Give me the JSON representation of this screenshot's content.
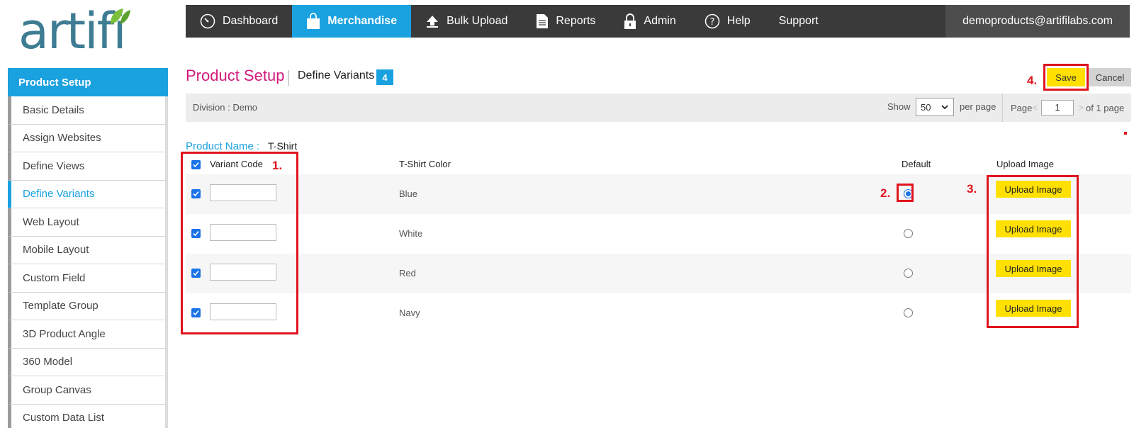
{
  "logo": {
    "text": "artifi"
  },
  "nav": {
    "items": [
      {
        "label": "Dashboard",
        "icon": "speedometer-icon",
        "active": false
      },
      {
        "label": "Merchandise",
        "icon": "shopping-bag-icon",
        "active": true
      },
      {
        "label": "Bulk Upload",
        "icon": "upload-icon",
        "active": false
      },
      {
        "label": "Reports",
        "icon": "document-icon",
        "active": false
      },
      {
        "label": "Admin",
        "icon": "lock-icon",
        "active": false
      },
      {
        "label": "Help",
        "icon": "help-icon",
        "active": false
      },
      {
        "label": "Support",
        "icon": "",
        "active": false
      }
    ],
    "user": "demoproducts@artifilabs.com"
  },
  "sidebar": {
    "header": "Product Setup",
    "items": [
      {
        "label": "Basic Details",
        "active": false
      },
      {
        "label": "Assign Websites",
        "active": false
      },
      {
        "label": "Define Views",
        "active": false
      },
      {
        "label": "Define Variants",
        "active": true
      },
      {
        "label": "Web Layout",
        "active": false
      },
      {
        "label": "Mobile Layout",
        "active": false
      },
      {
        "label": "Custom Field",
        "active": false
      },
      {
        "label": "Template Group",
        "active": false
      },
      {
        "label": "3D Product Angle",
        "active": false
      },
      {
        "label": "360 Model",
        "active": false
      },
      {
        "label": "Group Canvas",
        "active": false
      },
      {
        "label": "Custom Data List",
        "active": false
      }
    ]
  },
  "header": {
    "title": "Product Setup",
    "subtitle": "Define Variants",
    "step": "4",
    "save_label": "Save",
    "cancel_label": "Cancel"
  },
  "filter": {
    "division": "Division :  Demo",
    "show_label": "Show",
    "show_value": "50",
    "per_page_label": "per page",
    "page_label": "Page",
    "prev": "<",
    "page_value": "1",
    "next": ">",
    "of_label": "of 1 page"
  },
  "product": {
    "name_label": "Product Name :",
    "name_value": "T-Shirt"
  },
  "table": {
    "headers": {
      "code": "Variant Code",
      "color": "T-Shirt Color",
      "default": "Default",
      "upload": "Upload Image"
    },
    "rows": [
      {
        "code": "",
        "color": "Blue",
        "default": true,
        "upload": "Upload Image"
      },
      {
        "code": "",
        "color": "White",
        "default": false,
        "upload": "Upload Image"
      },
      {
        "code": "",
        "color": "Red",
        "default": false,
        "upload": "Upload Image"
      },
      {
        "code": "",
        "color": "Navy",
        "default": false,
        "upload": "Upload Image"
      }
    ]
  },
  "annotations": {
    "n1": "1.",
    "n2": "2.",
    "n3": "3.",
    "n4": "4."
  },
  "colors": {
    "accent": "#1aa1e0",
    "title": "#d21a7b",
    "button_yellow": "#ffe000",
    "annotation_red": "#e0141e"
  }
}
